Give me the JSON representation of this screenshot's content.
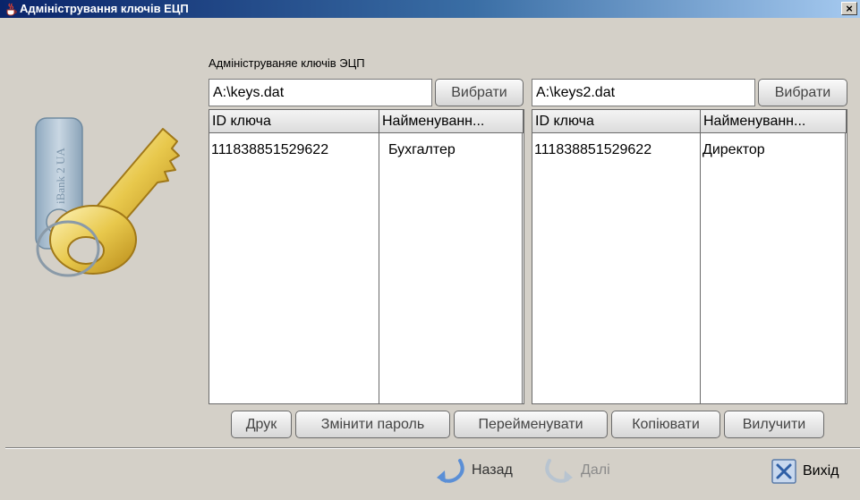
{
  "window": {
    "title": "Адміністрування ключів ЕЦП",
    "close_glyph": "×",
    "app_icon": "java-cup-icon"
  },
  "logo": {
    "text": "iBank 2 UA",
    "icon": "key-icon"
  },
  "section": {
    "label": "Адмініструваняе ключів ЭЦП"
  },
  "left_panel": {
    "file_path": "A:\\keys.dat",
    "choose_label": "Вибрати",
    "table": {
      "headers": [
        "ID ключа",
        "Найменуванн..."
      ],
      "rows": [
        [
          "111838851529622",
          "Бухгалтер"
        ]
      ]
    }
  },
  "right_panel": {
    "file_path": "A:\\keys2.dat",
    "choose_label": "Вибрати",
    "table": {
      "headers": [
        "ID ключа",
        "Найменуванн..."
      ],
      "rows": [
        [
          "111838851529622",
          "Директор"
        ]
      ]
    }
  },
  "actions": {
    "print": "Друк",
    "change_password": "Змінити пароль",
    "rename": "Перейменувати",
    "copy": "Копіювати",
    "delete": "Вилучити"
  },
  "nav": {
    "back": "Назад",
    "next": "Далі",
    "exit": "Вихід"
  },
  "colors": {
    "background": "#d4d0c8",
    "titlebar_start": "#0a246a",
    "titlebar_end": "#a6caf0",
    "key_gold": "#e8c84c"
  }
}
